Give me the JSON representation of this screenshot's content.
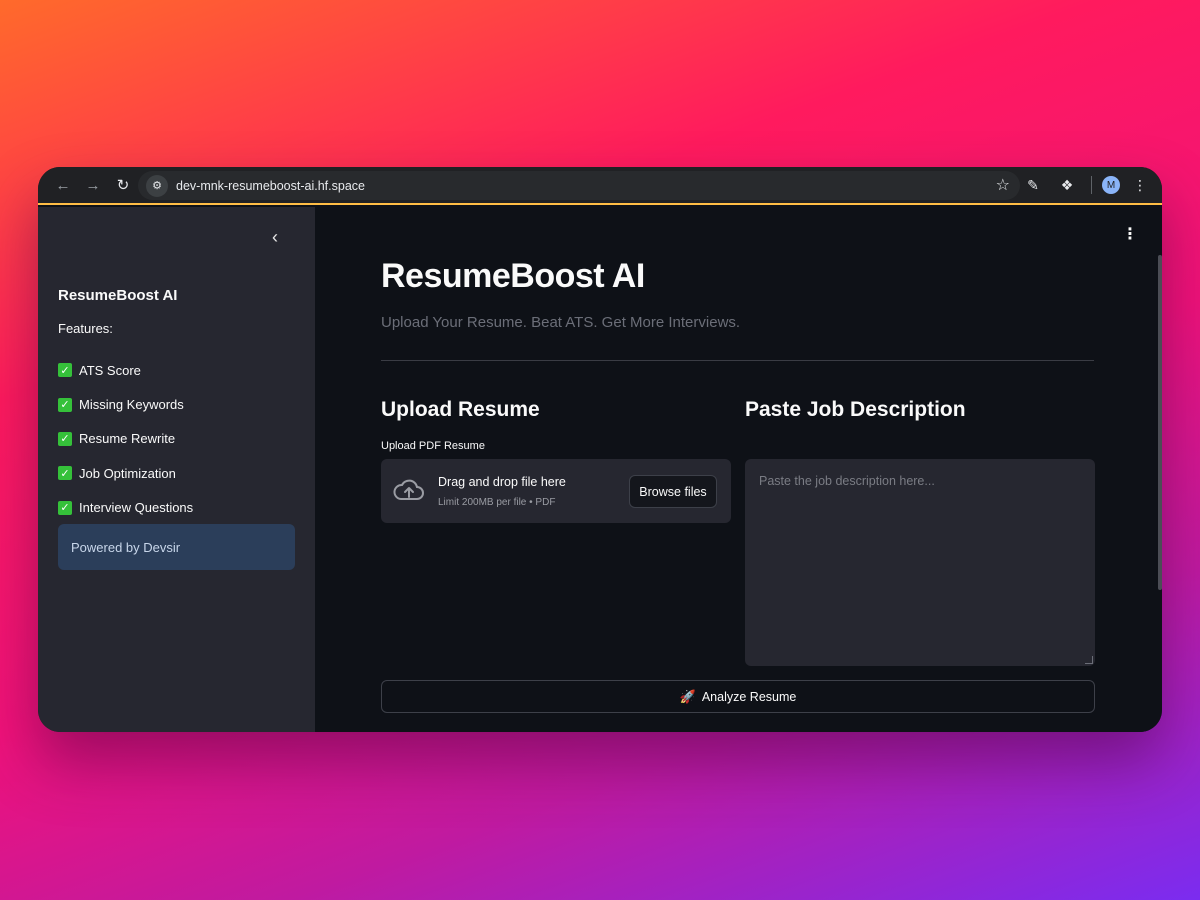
{
  "browser": {
    "url": "dev-mnk-resumeboost-ai.hf.space",
    "avatar_initial": "M"
  },
  "sidebar": {
    "title": "ResumeBoost AI",
    "features_label": "Features:",
    "items": [
      {
        "label": "ATS Score"
      },
      {
        "label": "Missing Keywords"
      },
      {
        "label": "Resume Rewrite"
      },
      {
        "label": "Job Optimization"
      },
      {
        "label": "Interview Questions"
      }
    ],
    "powered_by": "Powered by Devsir"
  },
  "main": {
    "title": "ResumeBoost AI",
    "subtitle": "Upload Your Resume. Beat ATS. Get More Interviews.",
    "upload": {
      "heading": "Upload Resume",
      "label": "Upload PDF Resume",
      "drop_text": "Drag and drop file here",
      "limit_text": "Limit 200MB per file • PDF",
      "browse_label": "Browse files"
    },
    "job": {
      "heading": "Paste Job Description",
      "placeholder": "Paste the job description here...",
      "value": ""
    },
    "analyze_label": "Analyze Resume"
  },
  "colors": {
    "accent_check": "#35c13a",
    "powered_bg": "#2b3e5a",
    "main_bg": "#0e1117",
    "sidebar_bg": "#262730"
  }
}
